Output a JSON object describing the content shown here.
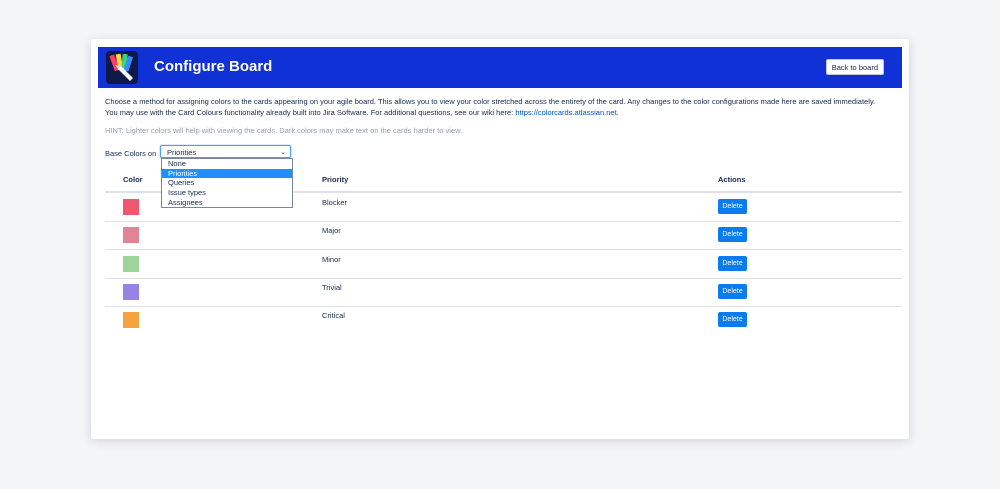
{
  "header": {
    "title": "Configure Board",
    "back_label": "Back to board"
  },
  "description": {
    "line1": "Choose a method for assigning colors to the cards appearing on your agile board. This allows you to view your color stretched across the entirety of the card. Any changes to the color configurations made here are saved immediately.",
    "line2_prefix": "You may use with the Card Colours functionality already built into Jira Software. For additional questions, see our wiki here: ",
    "wiki_link": "https://colorcards.atlassian.net",
    "line2_suffix": "."
  },
  "hint": "HINT: Lighter colors will help with viewing the cards. Dark colors may make text on the cards harder to view.",
  "base_colors": {
    "label": "Base Colors on",
    "selected": "Priorities",
    "options": [
      "None",
      "Priorities",
      "Queries",
      "Issue types",
      "Assignees"
    ]
  },
  "table": {
    "headers": {
      "color": "Color",
      "priority": "Priority",
      "actions": "Actions"
    },
    "delete_label": "Delete",
    "rows": [
      {
        "priority": "Blocker",
        "color": "#f0566e"
      },
      {
        "priority": "Major",
        "color": "#e08595"
      },
      {
        "priority": "Minor",
        "color": "#9ed49b"
      },
      {
        "priority": "Trivial",
        "color": "#9683e6"
      },
      {
        "priority": "Critical",
        "color": "#f7a33d"
      }
    ]
  },
  "colors": {
    "banner": "#1031d6",
    "delete_button": "#0a7cf0",
    "link": "#0052cc"
  },
  "icons": {
    "logo": "paint-brush-logo-icon",
    "select": "chevron-down-icon"
  }
}
